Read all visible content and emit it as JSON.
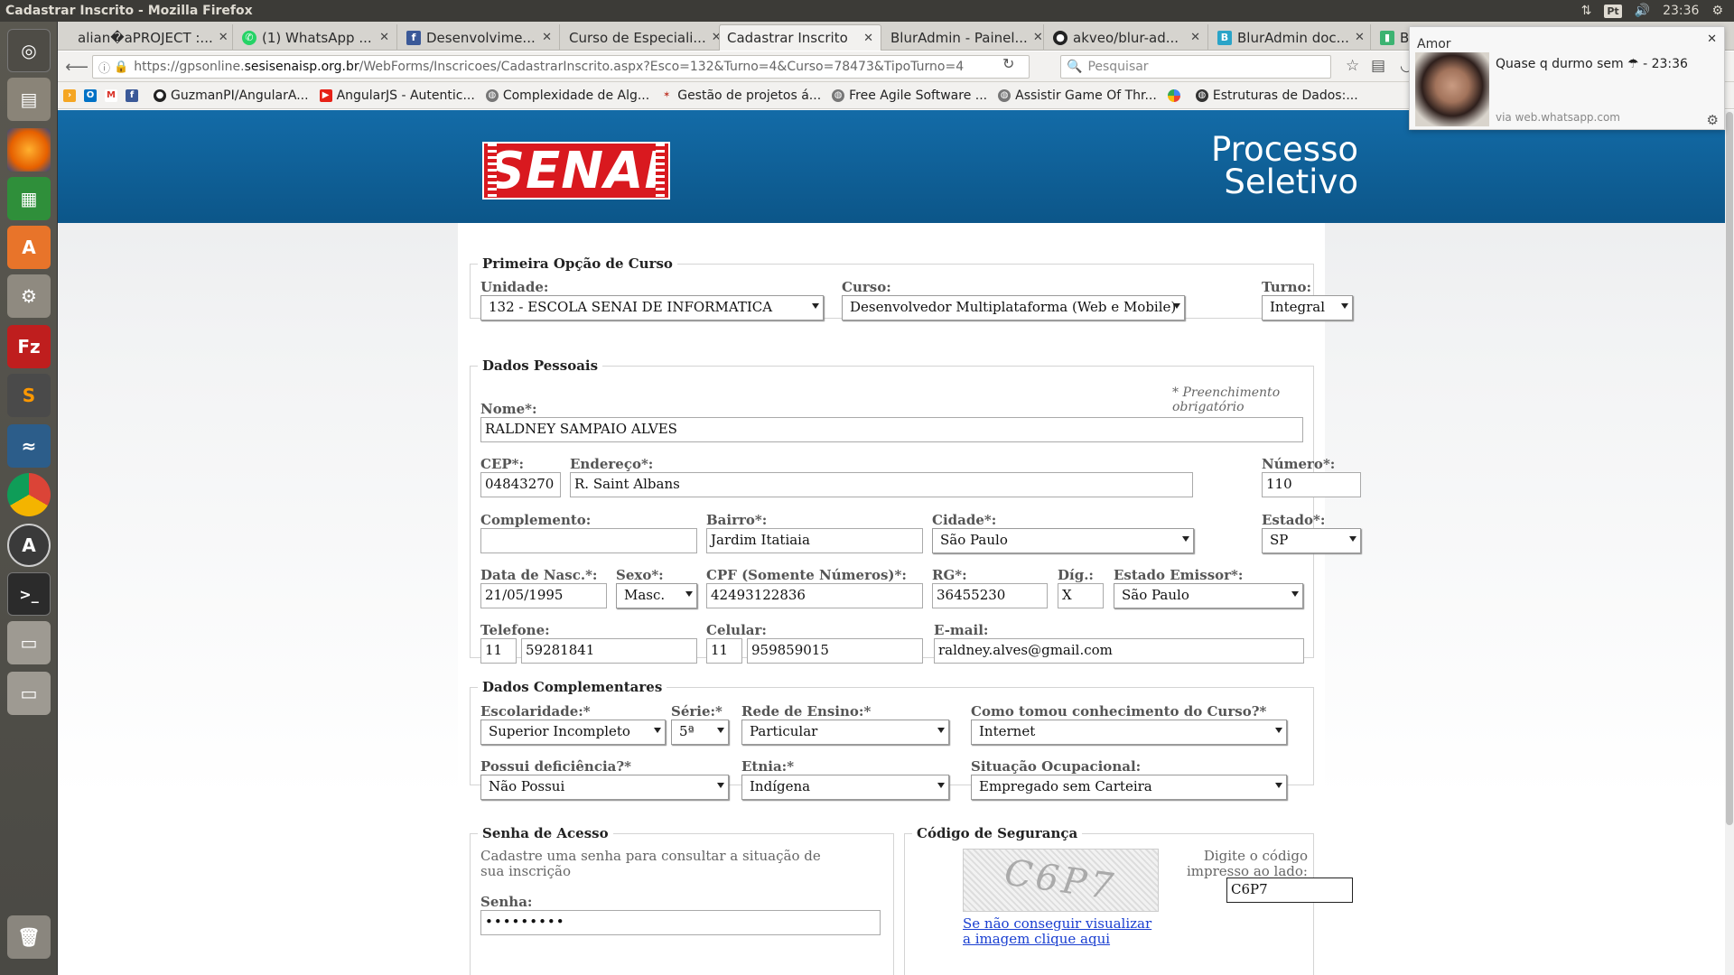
{
  "os": {
    "window_title": "Cadastrar Inscrito - Mozilla Firefox",
    "keyboard_layout": "Pt",
    "clock": "23:36"
  },
  "launcher": {
    "items": [
      "ubuntu-dash",
      "files",
      "firefox",
      "libreoffice-calc",
      "software-center",
      "system-settings",
      "filezilla",
      "sublime-text",
      "mysql-workbench",
      "chrome",
      "software-updater",
      "terminal",
      "disk-drive",
      "disk-drive-2",
      "trash"
    ]
  },
  "tabs": [
    {
      "label": "alian�aPROJECT :...",
      "icon": "none",
      "active": false
    },
    {
      "label": "(1) WhatsApp ...",
      "icon": "whatsapp-icon",
      "active": false
    },
    {
      "label": "Desenvolvime...",
      "icon": "facebook-icon",
      "active": false
    },
    {
      "label": "Curso de Especiali...",
      "icon": "none",
      "active": false
    },
    {
      "label": "Cadastrar Inscrito",
      "icon": "none",
      "active": true
    },
    {
      "label": "BlurAdmin - Painel...",
      "icon": "none",
      "active": false
    },
    {
      "label": "akveo/blur-ad...",
      "icon": "github-icon",
      "active": false
    },
    {
      "label": "BlurAdmin doc...",
      "icon": "bluradmin-icon",
      "active": false
    },
    {
      "label": "Blu",
      "icon": "chart-icon",
      "active": false
    }
  ],
  "navbar": {
    "url_prefix": "https://gpsonline.",
    "url_host": "sesisenaisp.org.br",
    "url_path": "/WebForms/Inscricoes/CadastrarInscrito.aspx?Esco=132&Turno=4&Curso=78473&TipoTurno=4",
    "search_placeholder": "Pesquisar"
  },
  "bookmarks": [
    {
      "label": "",
      "icon": "feed-icon"
    },
    {
      "label": "",
      "icon": "outlook-icon"
    },
    {
      "label": "",
      "icon": "gmail-icon"
    },
    {
      "label": "",
      "icon": "facebook-icon"
    },
    {
      "label": "GuzmanPI/AngularA...",
      "icon": "github-icon"
    },
    {
      "label": "AngularJS - Autentic...",
      "icon": "youtube-icon"
    },
    {
      "label": "Complexidade de Alg...",
      "icon": "globe-icon"
    },
    {
      "label": "Gestão de projetos á...",
      "icon": "star-icon"
    },
    {
      "label": "Free Agile Software ...",
      "icon": "globe-icon"
    },
    {
      "label": "Assistir Game Of Thr...",
      "icon": "globe-icon"
    },
    {
      "label": "",
      "icon": "google-icon"
    },
    {
      "label": "Estruturas de Dados:...",
      "icon": "globe-icon"
    }
  ],
  "notification": {
    "title": "Amor",
    "message": "Quase q durmo sem ☂ - 23:36",
    "source": "via web.whatsapp.com"
  },
  "header": {
    "logo": "SENAI",
    "title_line1": "Processo",
    "title_line2": "Seletivo"
  },
  "curso": {
    "legend": "Primeira Opção de Curso",
    "unidade_label": "Unidade:",
    "unidade_value": "132 - ESCOLA SENAI DE INFORMATICA",
    "curso_label": "Curso:",
    "curso_value": "Desenvolvedor Multiplataforma (Web e Mobile)",
    "turno_label": "Turno:",
    "turno_value": "Integral"
  },
  "pessoais": {
    "legend": "Dados Pessoais",
    "required_note": "* Preenchimento obrigatório",
    "nome_label": "Nome*:",
    "nome_value": "RALDNEY SAMPAIO ALVES",
    "cep_label": "CEP*:",
    "cep_value": "04843270",
    "endereco_label": "Endereço*:",
    "endereco_value": "R. Saint Albans",
    "numero_label": "Número*:",
    "numero_value": "110",
    "complemento_label": "Complemento:",
    "complemento_value": "",
    "bairro_label": "Bairro*:",
    "bairro_value": "Jardim Itatiaia",
    "cidade_label": "Cidade*:",
    "cidade_value": "São Paulo",
    "estado_label": "Estado*:",
    "estado_value": "SP",
    "nasc_label": "Data de Nasc.*:",
    "nasc_value": "21/05/1995",
    "sexo_label": "Sexo*:",
    "sexo_value": "Masc.",
    "cpf_label": "CPF (Somente Números)*:",
    "cpf_value": "42493122836",
    "rg_label": "RG*:",
    "rg_value": "36455230",
    "dig_label": "Díg.:",
    "dig_value": "X",
    "emissor_label": "Estado Emissor*:",
    "emissor_value": "São Paulo",
    "telefone_label": "Telefone:",
    "telefone_ddd": "11",
    "telefone_value": "59281841",
    "celular_label": "Celular:",
    "celular_ddd": "11",
    "celular_value": "959859015",
    "email_label": "E-mail:",
    "email_value": "raldney.alves@gmail.com"
  },
  "complementares": {
    "legend": "Dados Complementares",
    "escolaridade_label": "Escolaridade:*",
    "escolaridade_value": "Superior Incompleto",
    "serie_label": "Série:*",
    "serie_value": "5ª",
    "rede_label": "Rede de Ensino:*",
    "rede_value": "Particular",
    "conhecimento_label": "Como tomou conhecimento do Curso?*",
    "conhecimento_value": "Internet",
    "deficiencia_label": "Possui deficiência?*",
    "deficiencia_value": "Não Possui",
    "etnia_label": "Etnia:*",
    "etnia_value": "Indígena",
    "situacao_label": "Situação Ocupacional:",
    "situacao_value": "Empregado sem Carteira"
  },
  "senha": {
    "legend": "Senha de Acesso",
    "help": "Cadastre uma senha para consultar a situação de sua inscrição",
    "senha_label": "Senha:",
    "senha_value": "•••••••••"
  },
  "seguranca": {
    "legend": "Código de Segurança",
    "captcha_text": "C6P7",
    "help": "Digite o código impresso ao lado:",
    "codigo_value": "C6P7",
    "link": "Se não conseguir visualizar a imagem clique aqui"
  }
}
